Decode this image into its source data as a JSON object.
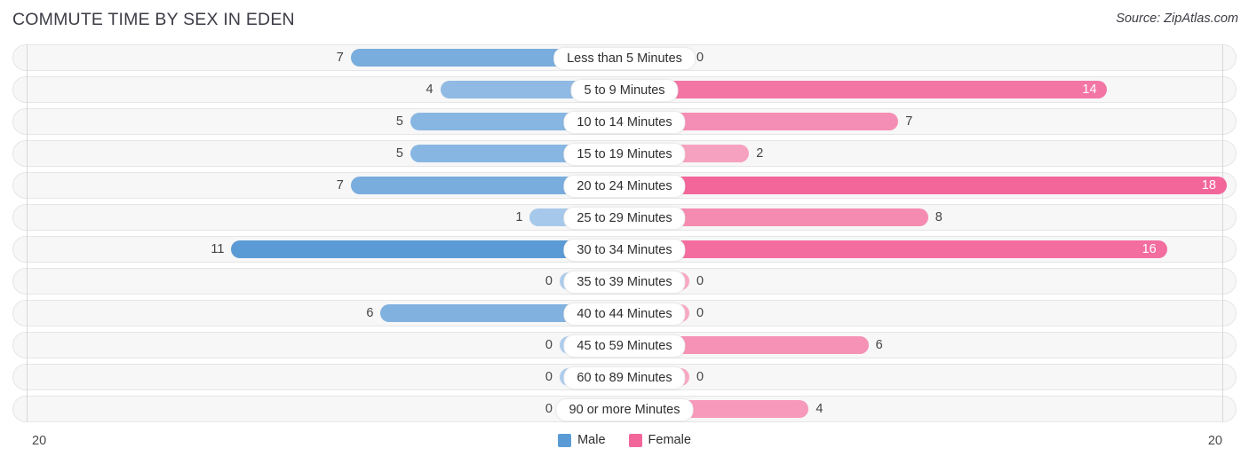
{
  "header": {
    "title": "COMMUTE TIME BY SEX IN EDEN",
    "source": "Source: ZipAtlas.com"
  },
  "axis": {
    "left_label": "20",
    "right_label": "20"
  },
  "legend": [
    {
      "label": "Male",
      "color": "#5B9BD5"
    },
    {
      "label": "Female",
      "color": "#F2669A"
    }
  ],
  "colors": {
    "male_max": "#5B9BD5",
    "male_min": "#AECCEC",
    "female_max": "#F2669A",
    "female_min": "#F7A8C4",
    "track_bg": "#f7f7f7",
    "track_border": "#e6e6e6",
    "gridline": "#d8d8d8"
  },
  "chart_data": {
    "type": "bar",
    "orientation": "horizontal",
    "layout": "diverging-bidirectional",
    "title": "COMMUTE TIME BY SEX IN EDEN",
    "xlabel": "",
    "ylabel": "",
    "axis_max": 20,
    "xlim": [
      20,
      20
    ],
    "grid": true,
    "legend_position": "bottom-center",
    "categories": [
      "Less than 5 Minutes",
      "5 to 9 Minutes",
      "10 to 14 Minutes",
      "15 to 19 Minutes",
      "20 to 24 Minutes",
      "25 to 29 Minutes",
      "30 to 34 Minutes",
      "35 to 39 Minutes",
      "40 to 44 Minutes",
      "45 to 59 Minutes",
      "60 to 89 Minutes",
      "90 or more Minutes"
    ],
    "series": [
      {
        "name": "Male",
        "color": "#5B9BD5",
        "direction": "left",
        "values": [
          7,
          4,
          5,
          5,
          7,
          1,
          11,
          0,
          6,
          0,
          0,
          0
        ]
      },
      {
        "name": "Female",
        "color": "#F2669A",
        "direction": "right",
        "values": [
          0,
          14,
          7,
          2,
          18,
          8,
          16,
          0,
          0,
          6,
          0,
          4
        ]
      }
    ]
  }
}
